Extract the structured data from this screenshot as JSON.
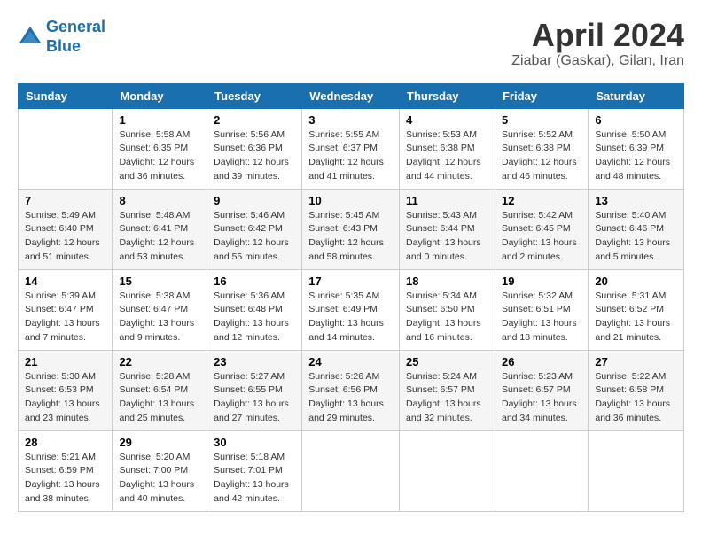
{
  "header": {
    "logo_line1": "General",
    "logo_line2": "Blue",
    "title": "April 2024",
    "subtitle": "Ziabar (Gaskar), Gilan, Iran"
  },
  "columns": [
    "Sunday",
    "Monday",
    "Tuesday",
    "Wednesday",
    "Thursday",
    "Friday",
    "Saturday"
  ],
  "weeks": [
    [
      {
        "day": "",
        "sunrise": "",
        "sunset": "",
        "daylight": ""
      },
      {
        "day": "1",
        "sunrise": "Sunrise: 5:58 AM",
        "sunset": "Sunset: 6:35 PM",
        "daylight": "Daylight: 12 hours and 36 minutes."
      },
      {
        "day": "2",
        "sunrise": "Sunrise: 5:56 AM",
        "sunset": "Sunset: 6:36 PM",
        "daylight": "Daylight: 12 hours and 39 minutes."
      },
      {
        "day": "3",
        "sunrise": "Sunrise: 5:55 AM",
        "sunset": "Sunset: 6:37 PM",
        "daylight": "Daylight: 12 hours and 41 minutes."
      },
      {
        "day": "4",
        "sunrise": "Sunrise: 5:53 AM",
        "sunset": "Sunset: 6:38 PM",
        "daylight": "Daylight: 12 hours and 44 minutes."
      },
      {
        "day": "5",
        "sunrise": "Sunrise: 5:52 AM",
        "sunset": "Sunset: 6:38 PM",
        "daylight": "Daylight: 12 hours and 46 minutes."
      },
      {
        "day": "6",
        "sunrise": "Sunrise: 5:50 AM",
        "sunset": "Sunset: 6:39 PM",
        "daylight": "Daylight: 12 hours and 48 minutes."
      }
    ],
    [
      {
        "day": "7",
        "sunrise": "Sunrise: 5:49 AM",
        "sunset": "Sunset: 6:40 PM",
        "daylight": "Daylight: 12 hours and 51 minutes."
      },
      {
        "day": "8",
        "sunrise": "Sunrise: 5:48 AM",
        "sunset": "Sunset: 6:41 PM",
        "daylight": "Daylight: 12 hours and 53 minutes."
      },
      {
        "day": "9",
        "sunrise": "Sunrise: 5:46 AM",
        "sunset": "Sunset: 6:42 PM",
        "daylight": "Daylight: 12 hours and 55 minutes."
      },
      {
        "day": "10",
        "sunrise": "Sunrise: 5:45 AM",
        "sunset": "Sunset: 6:43 PM",
        "daylight": "Daylight: 12 hours and 58 minutes."
      },
      {
        "day": "11",
        "sunrise": "Sunrise: 5:43 AM",
        "sunset": "Sunset: 6:44 PM",
        "daylight": "Daylight: 13 hours and 0 minutes."
      },
      {
        "day": "12",
        "sunrise": "Sunrise: 5:42 AM",
        "sunset": "Sunset: 6:45 PM",
        "daylight": "Daylight: 13 hours and 2 minutes."
      },
      {
        "day": "13",
        "sunrise": "Sunrise: 5:40 AM",
        "sunset": "Sunset: 6:46 PM",
        "daylight": "Daylight: 13 hours and 5 minutes."
      }
    ],
    [
      {
        "day": "14",
        "sunrise": "Sunrise: 5:39 AM",
        "sunset": "Sunset: 6:47 PM",
        "daylight": "Daylight: 13 hours and 7 minutes."
      },
      {
        "day": "15",
        "sunrise": "Sunrise: 5:38 AM",
        "sunset": "Sunset: 6:47 PM",
        "daylight": "Daylight: 13 hours and 9 minutes."
      },
      {
        "day": "16",
        "sunrise": "Sunrise: 5:36 AM",
        "sunset": "Sunset: 6:48 PM",
        "daylight": "Daylight: 13 hours and 12 minutes."
      },
      {
        "day": "17",
        "sunrise": "Sunrise: 5:35 AM",
        "sunset": "Sunset: 6:49 PM",
        "daylight": "Daylight: 13 hours and 14 minutes."
      },
      {
        "day": "18",
        "sunrise": "Sunrise: 5:34 AM",
        "sunset": "Sunset: 6:50 PM",
        "daylight": "Daylight: 13 hours and 16 minutes."
      },
      {
        "day": "19",
        "sunrise": "Sunrise: 5:32 AM",
        "sunset": "Sunset: 6:51 PM",
        "daylight": "Daylight: 13 hours and 18 minutes."
      },
      {
        "day": "20",
        "sunrise": "Sunrise: 5:31 AM",
        "sunset": "Sunset: 6:52 PM",
        "daylight": "Daylight: 13 hours and 21 minutes."
      }
    ],
    [
      {
        "day": "21",
        "sunrise": "Sunrise: 5:30 AM",
        "sunset": "Sunset: 6:53 PM",
        "daylight": "Daylight: 13 hours and 23 minutes."
      },
      {
        "day": "22",
        "sunrise": "Sunrise: 5:28 AM",
        "sunset": "Sunset: 6:54 PM",
        "daylight": "Daylight: 13 hours and 25 minutes."
      },
      {
        "day": "23",
        "sunrise": "Sunrise: 5:27 AM",
        "sunset": "Sunset: 6:55 PM",
        "daylight": "Daylight: 13 hours and 27 minutes."
      },
      {
        "day": "24",
        "sunrise": "Sunrise: 5:26 AM",
        "sunset": "Sunset: 6:56 PM",
        "daylight": "Daylight: 13 hours and 29 minutes."
      },
      {
        "day": "25",
        "sunrise": "Sunrise: 5:24 AM",
        "sunset": "Sunset: 6:57 PM",
        "daylight": "Daylight: 13 hours and 32 minutes."
      },
      {
        "day": "26",
        "sunrise": "Sunrise: 5:23 AM",
        "sunset": "Sunset: 6:57 PM",
        "daylight": "Daylight: 13 hours and 34 minutes."
      },
      {
        "day": "27",
        "sunrise": "Sunrise: 5:22 AM",
        "sunset": "Sunset: 6:58 PM",
        "daylight": "Daylight: 13 hours and 36 minutes."
      }
    ],
    [
      {
        "day": "28",
        "sunrise": "Sunrise: 5:21 AM",
        "sunset": "Sunset: 6:59 PM",
        "daylight": "Daylight: 13 hours and 38 minutes."
      },
      {
        "day": "29",
        "sunrise": "Sunrise: 5:20 AM",
        "sunset": "Sunset: 7:00 PM",
        "daylight": "Daylight: 13 hours and 40 minutes."
      },
      {
        "day": "30",
        "sunrise": "Sunrise: 5:18 AM",
        "sunset": "Sunset: 7:01 PM",
        "daylight": "Daylight: 13 hours and 42 minutes."
      },
      {
        "day": "",
        "sunrise": "",
        "sunset": "",
        "daylight": ""
      },
      {
        "day": "",
        "sunrise": "",
        "sunset": "",
        "daylight": ""
      },
      {
        "day": "",
        "sunrise": "",
        "sunset": "",
        "daylight": ""
      },
      {
        "day": "",
        "sunrise": "",
        "sunset": "",
        "daylight": ""
      }
    ]
  ]
}
